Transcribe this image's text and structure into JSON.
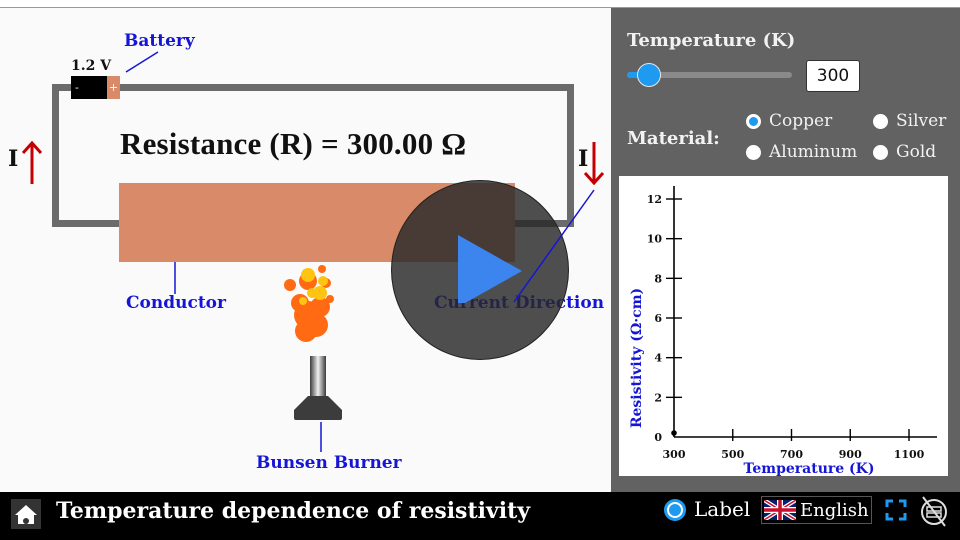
{
  "simulation": {
    "battery": {
      "label": "Battery",
      "voltage": "1.2 V",
      "neg_sign": "-",
      "pos_sign": "+"
    },
    "resistance_text": "Resistance (R) = 300.00 Ω",
    "current_symbol": "I",
    "labels": {
      "conductor": "Conductor",
      "current_direction": "Current Direction",
      "bunsen_burner": "Bunsen Burner"
    },
    "colors": {
      "conductor": "#d98a68",
      "wire": "#6b6b6b",
      "arrow": "#c40000",
      "label": "#1515d6"
    }
  },
  "panel": {
    "temperature_title": "Temperature (K)",
    "temperature_value": "300",
    "temperature_slider_fraction": 0.0,
    "material_label": "Material:",
    "materials": [
      {
        "label": "Copper",
        "selected": true
      },
      {
        "label": "Silver",
        "selected": false
      },
      {
        "label": "Aluminum",
        "selected": false
      },
      {
        "label": "Gold",
        "selected": false
      }
    ]
  },
  "chart_data": {
    "type": "scatter",
    "title": "",
    "xlabel": "Temperature (K)",
    "ylabel": "Resistivity (Ω·cm)",
    "x_ticks": [
      300,
      500,
      700,
      900,
      1100
    ],
    "y_ticks": [
      0,
      2,
      4,
      6,
      8,
      10,
      12
    ],
    "xlim": [
      300,
      1180
    ],
    "ylim": [
      0,
      12.7
    ],
    "grid": false,
    "series": [
      {
        "name": "Copper",
        "x": [
          300
        ],
        "y": [
          0.2
        ]
      }
    ]
  },
  "bottom_bar": {
    "title": "Temperature dependence of resistivity",
    "label_toggle": "Label",
    "language": "English"
  }
}
